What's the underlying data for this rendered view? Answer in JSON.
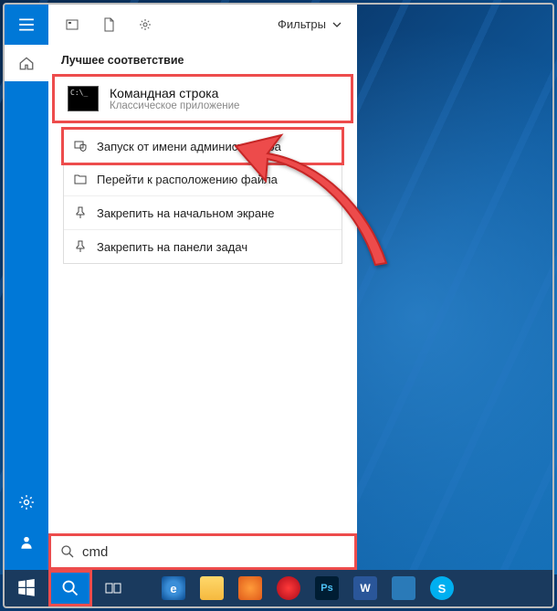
{
  "toolbar": {
    "filters_label": "Фильтры"
  },
  "section": {
    "best_match_label": "Лучшее соответствие"
  },
  "best_match": {
    "title": "Командная строка",
    "subtitle": "Классическое приложение"
  },
  "context_menu": {
    "run_as_admin": "Запуск от имени администратора",
    "open_location": "Перейти к расположению файла",
    "pin_start": "Закрепить на начальном экране",
    "pin_taskbar": "Закрепить на панели задач"
  },
  "search": {
    "value": "cmd",
    "placeholder": ""
  },
  "taskbar_apps": {
    "ps": "Ps",
    "word": "W"
  }
}
